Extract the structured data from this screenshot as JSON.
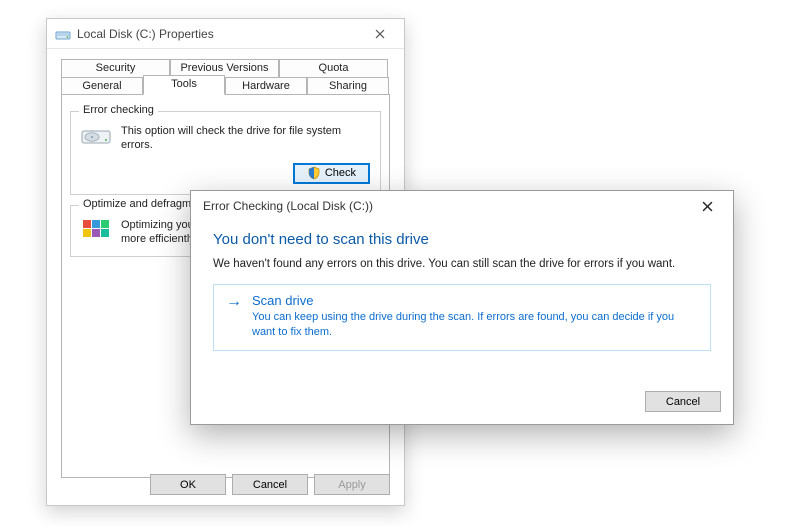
{
  "properties": {
    "title": "Local Disk (C:) Properties",
    "tabs_row1": [
      "Security",
      "Previous Versions",
      "Quota"
    ],
    "tabs_row2": [
      "General",
      "Tools",
      "Hardware",
      "Sharing"
    ],
    "active_tab": "Tools",
    "error_checking": {
      "legend": "Error checking",
      "blurb": "This option will check the drive for file system errors.",
      "button": "Check"
    },
    "optimize": {
      "legend": "Optimize and defragment drive",
      "blurb": "Optimizing your computer's drives can help it run more efficiently."
    },
    "buttons": {
      "ok": "OK",
      "cancel": "Cancel",
      "apply": "Apply"
    }
  },
  "errorcheck": {
    "title": "Error Checking (Local Disk (C:))",
    "headline": "You don't need to scan this drive",
    "body": "We haven't found any errors on this drive. You can still scan the drive for errors if you want.",
    "option_title": "Scan drive",
    "option_desc": "You can keep using the drive during the scan. If errors are found, you can decide if you want to fix them.",
    "cancel": "Cancel"
  }
}
